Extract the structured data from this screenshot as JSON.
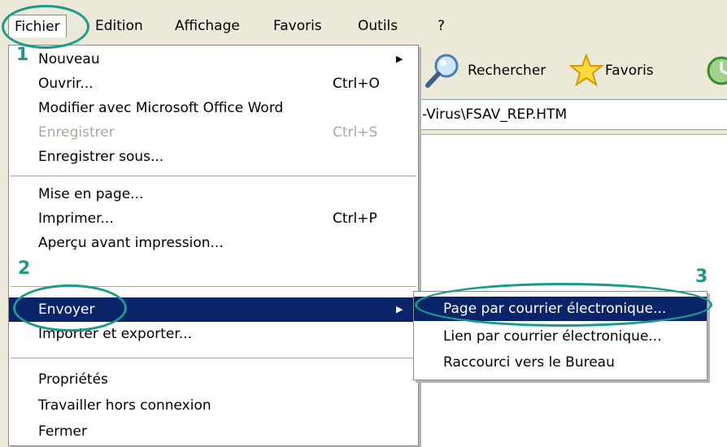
{
  "menubar": {
    "items": [
      "Fichier",
      "Edition",
      "Affichage",
      "Favoris",
      "Outils",
      "?"
    ]
  },
  "toolbar": {
    "search_label": "Rechercher",
    "favorites_label": "Favoris",
    "icons": [
      "search-icon",
      "favorites-star-icon",
      "history-icon"
    ]
  },
  "address": {
    "value": "-Virus\\FSAV_REP.HTM"
  },
  "file_menu": {
    "items": [
      {
        "label": "Nouveau",
        "shortcut": "",
        "submenu": true,
        "disabled": false
      },
      {
        "label": "Ouvrir...",
        "shortcut": "Ctrl+O",
        "submenu": false,
        "disabled": false
      },
      {
        "label": "Modifier avec Microsoft Office Word",
        "shortcut": "",
        "submenu": false,
        "disabled": false
      },
      {
        "label": "Enregistrer",
        "shortcut": "Ctrl+S",
        "submenu": false,
        "disabled": true
      },
      {
        "label": "Enregistrer sous...",
        "shortcut": "",
        "submenu": false,
        "disabled": false
      },
      {
        "label": "Mise en page...",
        "shortcut": "",
        "submenu": false,
        "disabled": false
      },
      {
        "label": "Imprimer...",
        "shortcut": "Ctrl+P",
        "submenu": false,
        "disabled": false
      },
      {
        "label": "Aperçu avant impression...",
        "shortcut": "",
        "submenu": false,
        "disabled": false
      },
      {
        "label": "Envoyer",
        "shortcut": "",
        "submenu": true,
        "disabled": false,
        "highlighted": true
      },
      {
        "label": "Importer et exporter...",
        "shortcut": "",
        "submenu": false,
        "disabled": false
      },
      {
        "label": "Propriétés",
        "shortcut": "",
        "submenu": false,
        "disabled": false
      },
      {
        "label": "Travailler hors connexion",
        "shortcut": "",
        "submenu": false,
        "disabled": false
      },
      {
        "label": "Fermer",
        "shortcut": "",
        "submenu": false,
        "disabled": false
      }
    ]
  },
  "send_submenu": {
    "items": [
      {
        "label": "Page par courrier électronique...",
        "highlighted": true
      },
      {
        "label": "Lien par courrier électronique..."
      },
      {
        "label": "Raccourci vers le Bureau"
      }
    ]
  },
  "annotations": {
    "step1": "1",
    "step2": "2",
    "step3": "3",
    "color": "#1a9a8a"
  },
  "colors": {
    "highlight": "#0a246a",
    "menu_bg": "#ffffff",
    "chrome_bg": "#ece9d8",
    "disabled": "#aca899"
  }
}
